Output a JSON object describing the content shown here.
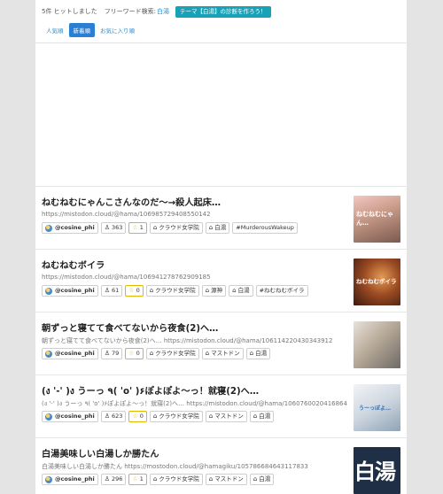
{
  "header": {
    "hit_count": "5件 ヒットしました",
    "free_word_label": "フリーワード検索:",
    "free_word_value": "白湯",
    "theme_button": "テーマ【白湯】の診断を作ろう！"
  },
  "tabs": [
    {
      "label": "人気順"
    },
    {
      "label": "新着順"
    },
    {
      "label": "お気に入り順"
    }
  ],
  "active_tab": "新着順",
  "colors": {
    "accent": "#2a7fd4",
    "theme_button": "#17a2b8",
    "star": "#e0b800"
  },
  "results": [
    {
      "title": "ねむねむにゃんこさんなのだ〜→殺人起床…",
      "sub": "https://mistodon.cloud/@hama/106985729408550142",
      "user": "@cosine_phi",
      "users": "363",
      "stars": "1",
      "tags": [
        "クラウド女学院",
        "白湯",
        "#MurderousWakeup"
      ],
      "thumb_text": "ねむねむにゃん…"
    },
    {
      "title": "ねむねむボイラ",
      "sub": "https://mistodon.cloud/@hama/106941278762909185",
      "user": "@cosine_phi",
      "users": "61",
      "stars": "0",
      "tags": [
        "クラウド女学院",
        "源神",
        "白湯",
        "#ねむねむボイラ"
      ],
      "thumb_text": "ねむねむボイラ"
    },
    {
      "title": "朝ずっと寝てて食べてないから夜食(2)へ…",
      "sub": "朝ずっと寝てて食べてないから夜食(2)へ…   https://mistodon.cloud/@hama/106114220430343912",
      "user": "@cosine_phi",
      "users": "79",
      "stars": "0",
      "tags": [
        "クラウド女学院",
        "マストドン",
        "白湯"
      ],
      "thumb_text": ""
    },
    {
      "title": "(ง '-' )ง うーっ ٩( 'o' )۶ぽよぽよ〜っ！就寝(2)へ…",
      "sub": "(ง '-' )ง うーっ ٩( 'o' )۶ぽよぽよ〜っ！就寝(2)へ… https://mistodon.cloud/@hama/106076002041686484",
      "user": "@cosine_phi",
      "users": "623",
      "stars": "0",
      "tags": [
        "クラウド女学院",
        "マストドン",
        "白湯"
      ],
      "thumb_text": "うーっぽよ…"
    },
    {
      "title": "白湯美味しい白湯しか勝たん",
      "sub": "白湯美味しい白湯しか勝たん https://mostodon.cloud/@hamagiku/105786684643117833",
      "user": "@cosine_phi",
      "users": "296",
      "stars": "1",
      "tags": [
        "クラウド女学院",
        "マストドン",
        "白湯"
      ],
      "thumb_text": "白湯"
    }
  ]
}
